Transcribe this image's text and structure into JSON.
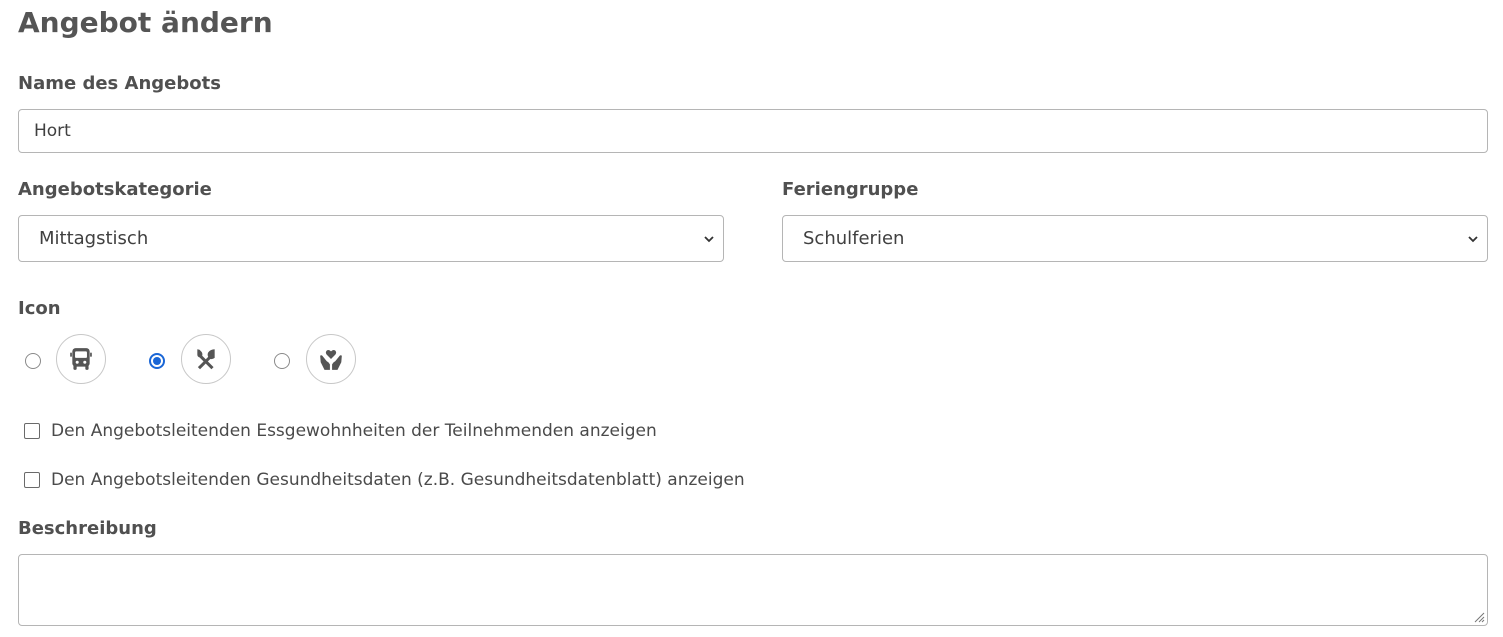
{
  "page": {
    "title": "Angebot ändern"
  },
  "name_field": {
    "label": "Name des Angebots",
    "value": "Hort"
  },
  "category": {
    "label": "Angebotskategorie",
    "selected": "Mittagstisch"
  },
  "holiday_group": {
    "label": "Feriengruppe",
    "selected": "Schulferien"
  },
  "icon_group": {
    "label": "Icon",
    "options": [
      {
        "icon": "bus-icon",
        "selected": false
      },
      {
        "icon": "utensils-icon",
        "selected": true
      },
      {
        "icon": "hands-heart-icon",
        "selected": false
      }
    ]
  },
  "checkboxes": [
    {
      "label": "Den Angebotsleitenden Essgewohnheiten der Teilnehmenden anzeigen",
      "checked": false
    },
    {
      "label": "Den Angebotsleitenden Gesundheitsdaten (z.B. Gesundheitsdatenblatt) anzeigen",
      "checked": false
    }
  ],
  "description": {
    "label": "Beschreibung",
    "value": ""
  },
  "colors": {
    "accent": "#1a66d6",
    "border": "#b5b5b5",
    "icon": "#555555"
  }
}
